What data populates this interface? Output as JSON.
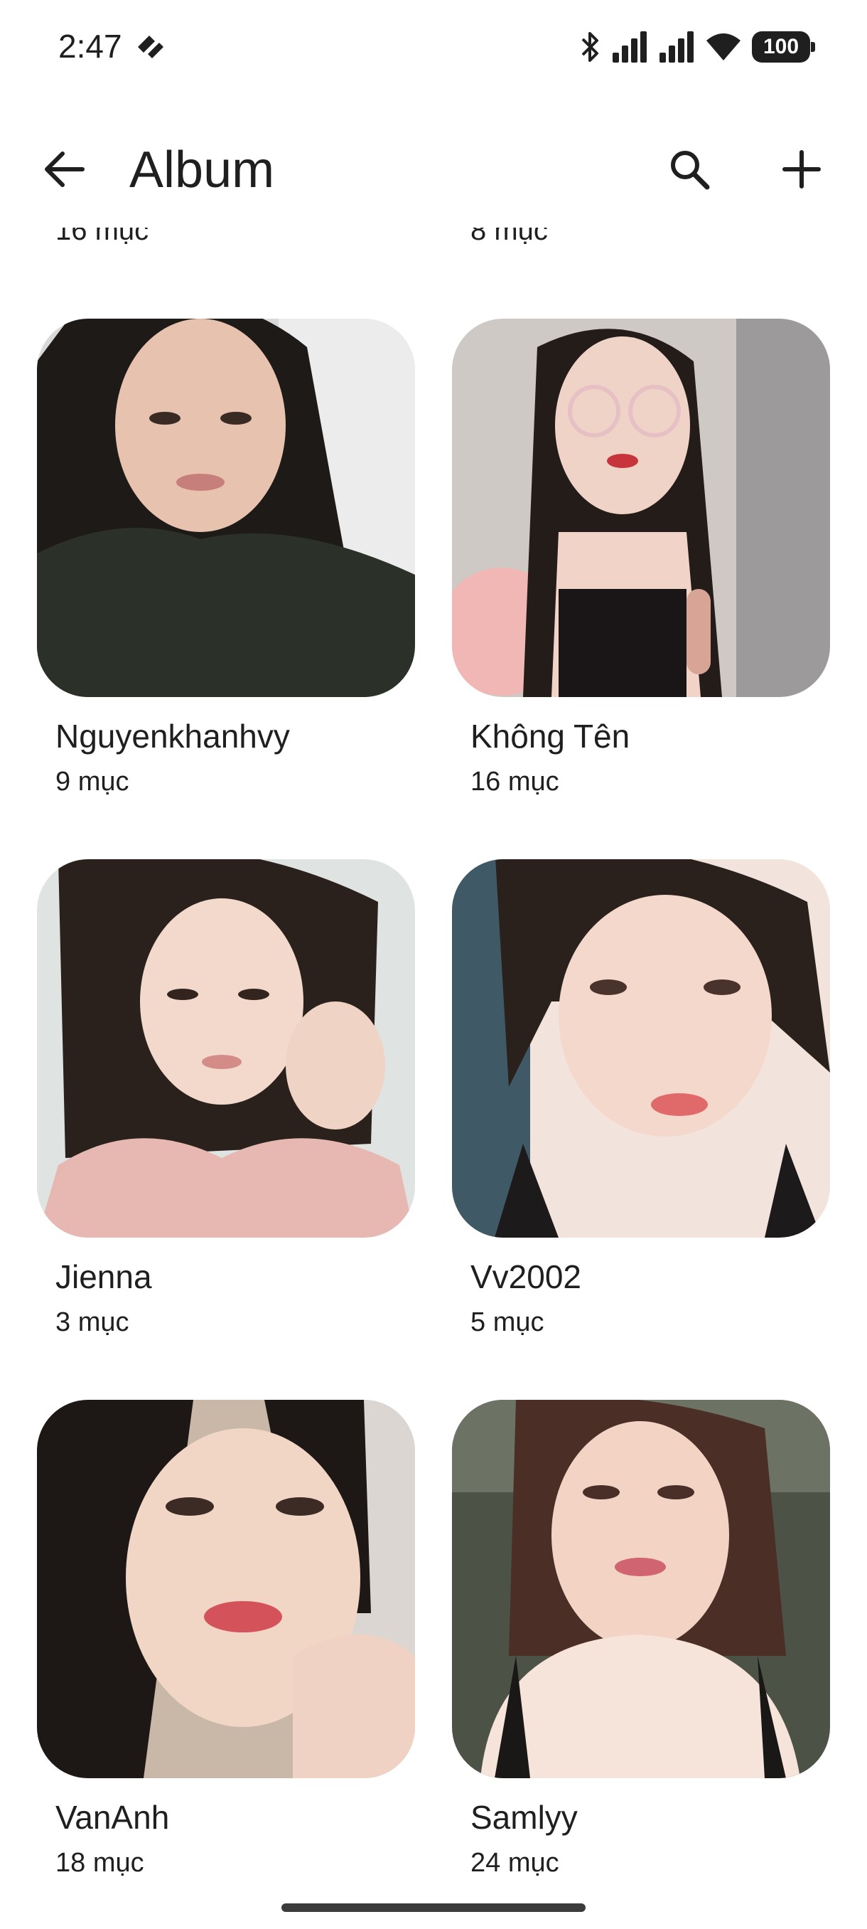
{
  "status_bar": {
    "time": "2:47",
    "battery": "100",
    "icons": [
      "pinwheel-icon",
      "bluetooth-icon",
      "signal-icon",
      "signal-icon",
      "wifi-icon",
      "battery-icon"
    ]
  },
  "app_bar": {
    "title": "Album",
    "back_icon": "arrow-left-icon",
    "search_icon": "search-icon",
    "add_icon": "plus-icon"
  },
  "partial_row": {
    "left_count": "16 mục",
    "right_count": "8 mục"
  },
  "albums": [
    {
      "name": "Nguyenkhanhvy",
      "count": "9 mục"
    },
    {
      "name": "Không Tên",
      "count": "16 mục"
    },
    {
      "name": "Jienna",
      "count": "3 mục"
    },
    {
      "name": "Vv2002",
      "count": "5 mục"
    },
    {
      "name": "VanAnh",
      "count": "18 mục"
    },
    {
      "name": "Samlyy",
      "count": "24 mục"
    }
  ],
  "colors": {
    "text": "#1f1f1f",
    "background": "#ffffff"
  }
}
